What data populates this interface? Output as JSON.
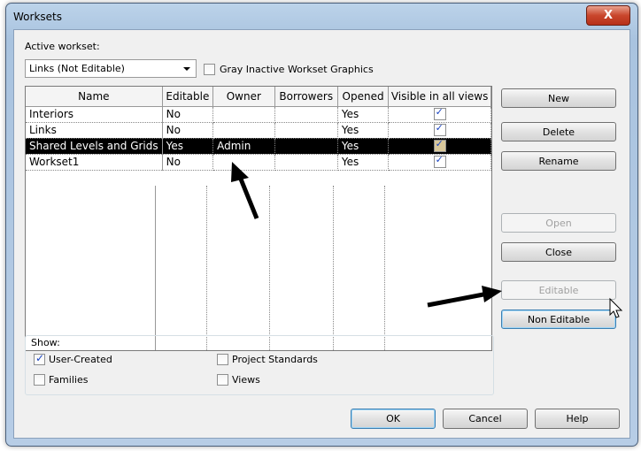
{
  "window": {
    "title": "Worksets",
    "close_glyph": "X"
  },
  "active_workset": {
    "label": "Active workset:",
    "value": "Links (Not Editable)",
    "gray_inactive_label": "Gray Inactive Workset Graphics",
    "gray_inactive_checked": false
  },
  "table": {
    "columns": [
      "Name",
      "Editable",
      "Owner",
      "Borrowers",
      "Opened",
      "Visible in all views"
    ],
    "rows": [
      {
        "name": "Interiors",
        "editable": "No",
        "owner": "",
        "borrowers": "",
        "opened": "Yes",
        "visible": true,
        "selected": false
      },
      {
        "name": "Links",
        "editable": "No",
        "owner": "",
        "borrowers": "",
        "opened": "Yes",
        "visible": true,
        "selected": false
      },
      {
        "name": "Shared Levels and Grids",
        "editable": "Yes",
        "owner": "Admin",
        "borrowers": "",
        "opened": "Yes",
        "visible": true,
        "selected": true
      },
      {
        "name": "Workset1",
        "editable": "No",
        "owner": "",
        "borrowers": "",
        "opened": "Yes",
        "visible": true,
        "selected": false
      }
    ]
  },
  "side_buttons": {
    "new": "New",
    "delete": "Delete",
    "rename": "Rename",
    "open": "Open",
    "close": "Close",
    "editable": "Editable",
    "non_editable": "Non Editable"
  },
  "show": {
    "label": "Show:",
    "user_created": "User-Created",
    "families": "Families",
    "project_standards": "Project Standards",
    "views": "Views",
    "user_created_checked": true
  },
  "footer": {
    "ok": "OK",
    "cancel": "Cancel",
    "help": "Help"
  },
  "colors": {
    "selection": "#000000",
    "accent": "#3c7fb1",
    "close": "#c9462c"
  }
}
